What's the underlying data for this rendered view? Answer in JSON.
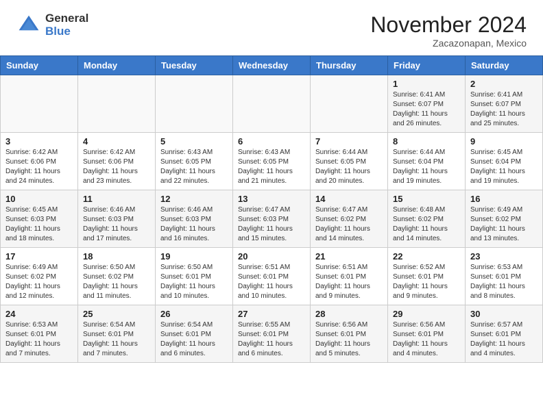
{
  "header": {
    "logo_general": "General",
    "logo_blue": "Blue",
    "month_title": "November 2024",
    "location": "Zacazonapan, Mexico"
  },
  "weekdays": [
    "Sunday",
    "Monday",
    "Tuesday",
    "Wednesday",
    "Thursday",
    "Friday",
    "Saturday"
  ],
  "weeks": [
    [
      {
        "day": "",
        "detail": ""
      },
      {
        "day": "",
        "detail": ""
      },
      {
        "day": "",
        "detail": ""
      },
      {
        "day": "",
        "detail": ""
      },
      {
        "day": "",
        "detail": ""
      },
      {
        "day": "1",
        "detail": "Sunrise: 6:41 AM\nSunset: 6:07 PM\nDaylight: 11 hours and 26 minutes."
      },
      {
        "day": "2",
        "detail": "Sunrise: 6:41 AM\nSunset: 6:07 PM\nDaylight: 11 hours and 25 minutes."
      }
    ],
    [
      {
        "day": "3",
        "detail": "Sunrise: 6:42 AM\nSunset: 6:06 PM\nDaylight: 11 hours and 24 minutes."
      },
      {
        "day": "4",
        "detail": "Sunrise: 6:42 AM\nSunset: 6:06 PM\nDaylight: 11 hours and 23 minutes."
      },
      {
        "day": "5",
        "detail": "Sunrise: 6:43 AM\nSunset: 6:05 PM\nDaylight: 11 hours and 22 minutes."
      },
      {
        "day": "6",
        "detail": "Sunrise: 6:43 AM\nSunset: 6:05 PM\nDaylight: 11 hours and 21 minutes."
      },
      {
        "day": "7",
        "detail": "Sunrise: 6:44 AM\nSunset: 6:05 PM\nDaylight: 11 hours and 20 minutes."
      },
      {
        "day": "8",
        "detail": "Sunrise: 6:44 AM\nSunset: 6:04 PM\nDaylight: 11 hours and 19 minutes."
      },
      {
        "day": "9",
        "detail": "Sunrise: 6:45 AM\nSunset: 6:04 PM\nDaylight: 11 hours and 19 minutes."
      }
    ],
    [
      {
        "day": "10",
        "detail": "Sunrise: 6:45 AM\nSunset: 6:03 PM\nDaylight: 11 hours and 18 minutes."
      },
      {
        "day": "11",
        "detail": "Sunrise: 6:46 AM\nSunset: 6:03 PM\nDaylight: 11 hours and 17 minutes."
      },
      {
        "day": "12",
        "detail": "Sunrise: 6:46 AM\nSunset: 6:03 PM\nDaylight: 11 hours and 16 minutes."
      },
      {
        "day": "13",
        "detail": "Sunrise: 6:47 AM\nSunset: 6:03 PM\nDaylight: 11 hours and 15 minutes."
      },
      {
        "day": "14",
        "detail": "Sunrise: 6:47 AM\nSunset: 6:02 PM\nDaylight: 11 hours and 14 minutes."
      },
      {
        "day": "15",
        "detail": "Sunrise: 6:48 AM\nSunset: 6:02 PM\nDaylight: 11 hours and 14 minutes."
      },
      {
        "day": "16",
        "detail": "Sunrise: 6:49 AM\nSunset: 6:02 PM\nDaylight: 11 hours and 13 minutes."
      }
    ],
    [
      {
        "day": "17",
        "detail": "Sunrise: 6:49 AM\nSunset: 6:02 PM\nDaylight: 11 hours and 12 minutes."
      },
      {
        "day": "18",
        "detail": "Sunrise: 6:50 AM\nSunset: 6:02 PM\nDaylight: 11 hours and 11 minutes."
      },
      {
        "day": "19",
        "detail": "Sunrise: 6:50 AM\nSunset: 6:01 PM\nDaylight: 11 hours and 10 minutes."
      },
      {
        "day": "20",
        "detail": "Sunrise: 6:51 AM\nSunset: 6:01 PM\nDaylight: 11 hours and 10 minutes."
      },
      {
        "day": "21",
        "detail": "Sunrise: 6:51 AM\nSunset: 6:01 PM\nDaylight: 11 hours and 9 minutes."
      },
      {
        "day": "22",
        "detail": "Sunrise: 6:52 AM\nSunset: 6:01 PM\nDaylight: 11 hours and 9 minutes."
      },
      {
        "day": "23",
        "detail": "Sunrise: 6:53 AM\nSunset: 6:01 PM\nDaylight: 11 hours and 8 minutes."
      }
    ],
    [
      {
        "day": "24",
        "detail": "Sunrise: 6:53 AM\nSunset: 6:01 PM\nDaylight: 11 hours and 7 minutes."
      },
      {
        "day": "25",
        "detail": "Sunrise: 6:54 AM\nSunset: 6:01 PM\nDaylight: 11 hours and 7 minutes."
      },
      {
        "day": "26",
        "detail": "Sunrise: 6:54 AM\nSunset: 6:01 PM\nDaylight: 11 hours and 6 minutes."
      },
      {
        "day": "27",
        "detail": "Sunrise: 6:55 AM\nSunset: 6:01 PM\nDaylight: 11 hours and 6 minutes."
      },
      {
        "day": "28",
        "detail": "Sunrise: 6:56 AM\nSunset: 6:01 PM\nDaylight: 11 hours and 5 minutes."
      },
      {
        "day": "29",
        "detail": "Sunrise: 6:56 AM\nSunset: 6:01 PM\nDaylight: 11 hours and 4 minutes."
      },
      {
        "day": "30",
        "detail": "Sunrise: 6:57 AM\nSunset: 6:01 PM\nDaylight: 11 hours and 4 minutes."
      }
    ]
  ]
}
